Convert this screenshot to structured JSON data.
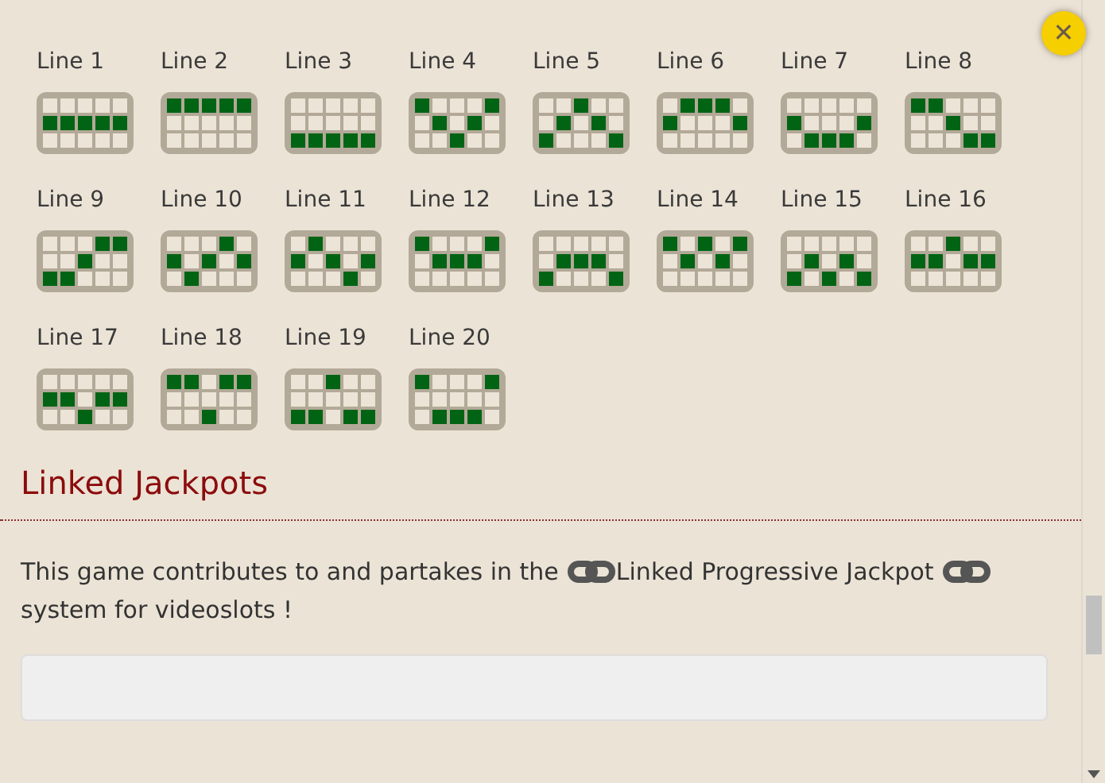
{
  "close_button": {
    "label": "✕"
  },
  "paylines": [
    {
      "label": "Line 1",
      "cells": [
        [
          false,
          false,
          false,
          false,
          false
        ],
        [
          true,
          true,
          true,
          true,
          true
        ],
        [
          false,
          false,
          false,
          false,
          false
        ]
      ]
    },
    {
      "label": "Line 2",
      "cells": [
        [
          true,
          true,
          true,
          true,
          true
        ],
        [
          false,
          false,
          false,
          false,
          false
        ],
        [
          false,
          false,
          false,
          false,
          false
        ]
      ]
    },
    {
      "label": "Line 3",
      "cells": [
        [
          false,
          false,
          false,
          false,
          false
        ],
        [
          false,
          false,
          false,
          false,
          false
        ],
        [
          true,
          true,
          true,
          true,
          true
        ]
      ]
    },
    {
      "label": "Line 4",
      "cells": [
        [
          true,
          false,
          false,
          false,
          true
        ],
        [
          false,
          true,
          false,
          true,
          false
        ],
        [
          false,
          false,
          true,
          false,
          false
        ]
      ]
    },
    {
      "label": "Line 5",
      "cells": [
        [
          false,
          false,
          true,
          false,
          false
        ],
        [
          false,
          true,
          false,
          true,
          false
        ],
        [
          true,
          false,
          false,
          false,
          true
        ]
      ]
    },
    {
      "label": "Line 6",
      "cells": [
        [
          false,
          true,
          true,
          true,
          false
        ],
        [
          true,
          false,
          false,
          false,
          true
        ],
        [
          false,
          false,
          false,
          false,
          false
        ]
      ]
    },
    {
      "label": "Line 7",
      "cells": [
        [
          false,
          false,
          false,
          false,
          false
        ],
        [
          true,
          false,
          false,
          false,
          true
        ],
        [
          false,
          true,
          true,
          true,
          false
        ]
      ]
    },
    {
      "label": "Line 8",
      "cells": [
        [
          true,
          true,
          false,
          false,
          false
        ],
        [
          false,
          false,
          true,
          false,
          false
        ],
        [
          false,
          false,
          false,
          true,
          true
        ]
      ]
    },
    {
      "label": "Line 9",
      "cells": [
        [
          false,
          false,
          false,
          true,
          true
        ],
        [
          false,
          false,
          true,
          false,
          false
        ],
        [
          true,
          true,
          false,
          false,
          false
        ]
      ]
    },
    {
      "label": "Line 10",
      "cells": [
        [
          false,
          false,
          false,
          true,
          false
        ],
        [
          true,
          false,
          true,
          false,
          true
        ],
        [
          false,
          true,
          false,
          false,
          false
        ]
      ]
    },
    {
      "label": "Line 11",
      "cells": [
        [
          false,
          true,
          false,
          false,
          false
        ],
        [
          true,
          false,
          true,
          false,
          true
        ],
        [
          false,
          false,
          false,
          true,
          false
        ]
      ]
    },
    {
      "label": "Line 12",
      "cells": [
        [
          true,
          false,
          false,
          false,
          true
        ],
        [
          false,
          true,
          true,
          true,
          false
        ],
        [
          false,
          false,
          false,
          false,
          false
        ]
      ]
    },
    {
      "label": "Line 13",
      "cells": [
        [
          false,
          false,
          false,
          false,
          false
        ],
        [
          false,
          true,
          true,
          true,
          false
        ],
        [
          true,
          false,
          false,
          false,
          true
        ]
      ]
    },
    {
      "label": "Line 14",
      "cells": [
        [
          true,
          false,
          true,
          false,
          true
        ],
        [
          false,
          true,
          false,
          true,
          false
        ],
        [
          false,
          false,
          false,
          false,
          false
        ]
      ]
    },
    {
      "label": "Line 15",
      "cells": [
        [
          false,
          false,
          false,
          false,
          false
        ],
        [
          false,
          true,
          false,
          true,
          false
        ],
        [
          true,
          false,
          true,
          false,
          true
        ]
      ]
    },
    {
      "label": "Line 16",
      "cells": [
        [
          false,
          false,
          true,
          false,
          false
        ],
        [
          true,
          true,
          false,
          true,
          true
        ],
        [
          false,
          false,
          false,
          false,
          false
        ]
      ]
    },
    {
      "label": "Line 17",
      "cells": [
        [
          false,
          false,
          false,
          false,
          false
        ],
        [
          true,
          true,
          false,
          true,
          true
        ],
        [
          false,
          false,
          true,
          false,
          false
        ]
      ]
    },
    {
      "label": "Line 18",
      "cells": [
        [
          true,
          true,
          false,
          true,
          true
        ],
        [
          false,
          false,
          false,
          false,
          false
        ],
        [
          false,
          false,
          true,
          false,
          false
        ]
      ]
    },
    {
      "label": "Line 19",
      "cells": [
        [
          false,
          false,
          true,
          false,
          false
        ],
        [
          false,
          false,
          false,
          false,
          false
        ],
        [
          true,
          true,
          false,
          true,
          true
        ]
      ]
    },
    {
      "label": "Line 20",
      "cells": [
        [
          true,
          false,
          false,
          false,
          true
        ],
        [
          false,
          false,
          false,
          false,
          false
        ],
        [
          false,
          true,
          true,
          true,
          false
        ]
      ]
    }
  ],
  "jackpot_section": {
    "heading": "Linked Jackpots",
    "text_before": "This game contributes to and partakes in the",
    "link_text": "Linked Progressive Jackpot",
    "text_after": "system for videoslots !"
  }
}
